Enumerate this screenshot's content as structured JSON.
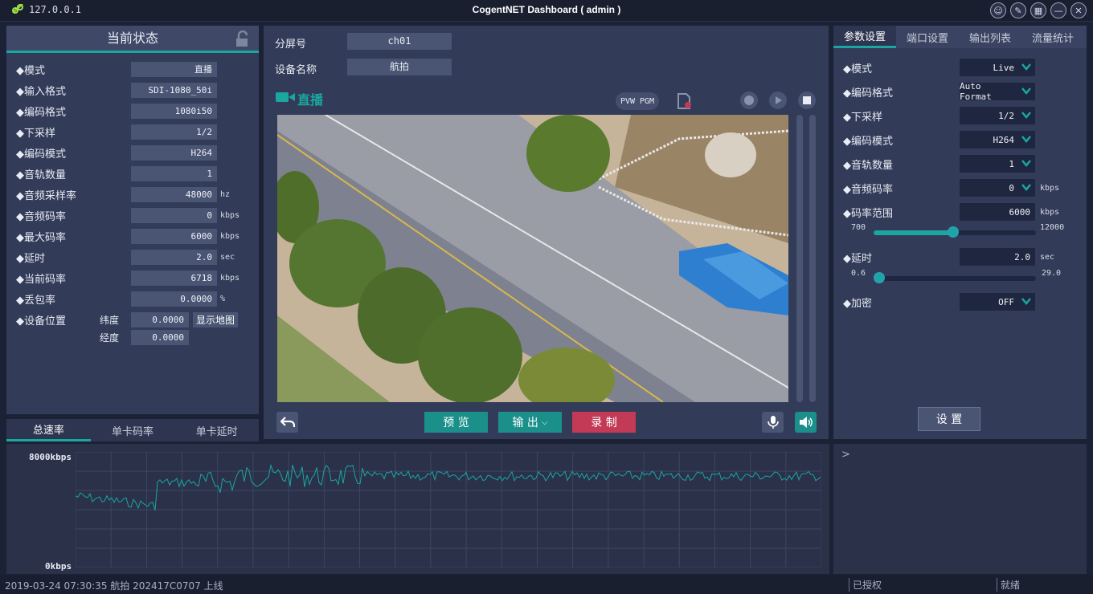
{
  "titlebar": {
    "ip": "127.0.0.1",
    "title": "CogentNET Dashboard ( admin )"
  },
  "left": {
    "title": "当前状态",
    "rows": [
      {
        "label": "◆模式",
        "value": "直播",
        "unit": ""
      },
      {
        "label": "◆输入格式",
        "value": "SDI-1080_50i",
        "unit": ""
      },
      {
        "label": "◆编码格式",
        "value": "1080i50",
        "unit": ""
      },
      {
        "label": "◆下采样",
        "value": "1/2",
        "unit": ""
      },
      {
        "label": "◆编码模式",
        "value": "H264",
        "unit": ""
      },
      {
        "label": "◆音轨数量",
        "value": "1",
        "unit": ""
      },
      {
        "label": "◆音频采样率",
        "value": "48000",
        "unit": "hz"
      },
      {
        "label": "◆音频码率",
        "value": "0",
        "unit": "kbps"
      },
      {
        "label": "◆最大码率",
        "value": "6000",
        "unit": "kbps"
      },
      {
        "label": "◆延时",
        "value": "2.0",
        "unit": "sec"
      },
      {
        "label": "◆当前码率",
        "value": "6718",
        "unit": "kbps"
      },
      {
        "label": "◆丢包率",
        "value": "0.0000",
        "unit": "%"
      }
    ],
    "location": {
      "label": "◆设备位置",
      "lat_label": "纬度",
      "lat": "0.0000",
      "lon_label": "经度",
      "lon": "0.0000",
      "map_button": "显示地图"
    }
  },
  "center": {
    "screen_label": "分屏号",
    "screen_value": "ch01",
    "device_label": "设备名称",
    "device_value": "航拍",
    "live_label": "直播",
    "pvw": "PVW",
    "pgm": "PGM",
    "preview_button": "预 览",
    "output_button": "输 出",
    "record_button": "录 制"
  },
  "right": {
    "tabs": [
      "参数设置",
      "端口设置",
      "输出列表",
      "流量统计"
    ],
    "rows": [
      {
        "label": "◆模式",
        "value": "Live",
        "unit": ""
      },
      {
        "label": "◆编码格式",
        "value": "Auto Format",
        "unit": ""
      },
      {
        "label": "◆下采样",
        "value": "1/2",
        "unit": ""
      },
      {
        "label": "◆编码模式",
        "value": "H264",
        "unit": ""
      },
      {
        "label": "◆音轨数量",
        "value": "1",
        "unit": ""
      },
      {
        "label": "◆音频码率",
        "value": "0",
        "unit": "kbps"
      }
    ],
    "bitrate": {
      "label": "◆码率范围",
      "value": "6000",
      "unit": "kbps",
      "min": "700",
      "max": "12000",
      "level": 0.49
    },
    "delay": {
      "label": "◆延时",
      "value": "2.0",
      "unit": "sec",
      "min": "0.6",
      "max": "29.0",
      "level": 0.0
    },
    "encrypt": {
      "label": "◆加密",
      "value": "OFF"
    },
    "set_button": "设 置"
  },
  "chart_tabs": [
    "总速率",
    "单卡码率",
    "单卡延时"
  ],
  "chart_data": {
    "type": "line",
    "ymax_label": "8000kbps",
    "ymin_label": "0kbps",
    "ylim": [
      0,
      8000
    ],
    "grid": true,
    "color": "#1ba6a0"
  },
  "log": {
    "arrow": ">"
  },
  "status": {
    "message": "2019-03-24 07:30:35 航拍 202417C0707 上线",
    "auth": "已授权",
    "state": "就绪"
  },
  "colors": {
    "accent": "#1ba6a0",
    "record": "#c23a55",
    "panel": "#323b58"
  }
}
